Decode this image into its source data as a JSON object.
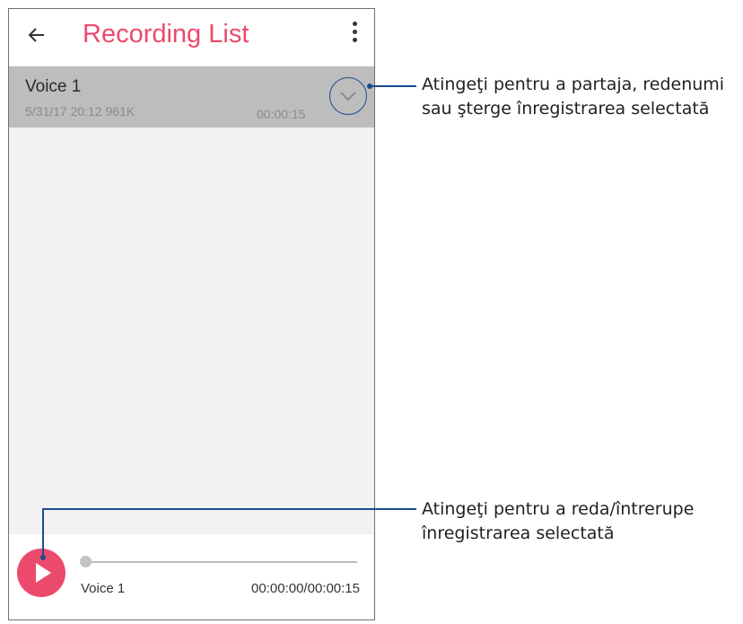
{
  "appbar": {
    "title": "Recording List",
    "back_icon": "arrow-left-icon",
    "menu_icon": "more-vert-icon"
  },
  "recordings": [
    {
      "name": "Voice 1",
      "meta": "5/31/17 20:12  961K",
      "duration": "00:00:15",
      "expand_icon": "chevron-down-icon"
    }
  ],
  "player": {
    "name": "Voice 1",
    "time": "00:00:00/00:00:15",
    "play_icon": "play-icon",
    "progress": 0
  },
  "callouts": {
    "expand_line1": "Atingeţi pentru a partaja, redenumi",
    "expand_line2": "sau şterge înregistrarea selectată",
    "play_line1": "Atingeţi pentru a reda/întrerupe",
    "play_line2": "înregistrarea selectată"
  },
  "colors": {
    "accent": "#ec4a6c",
    "callout": "#1a4c8e",
    "selected_row": "#bdbdbd"
  }
}
